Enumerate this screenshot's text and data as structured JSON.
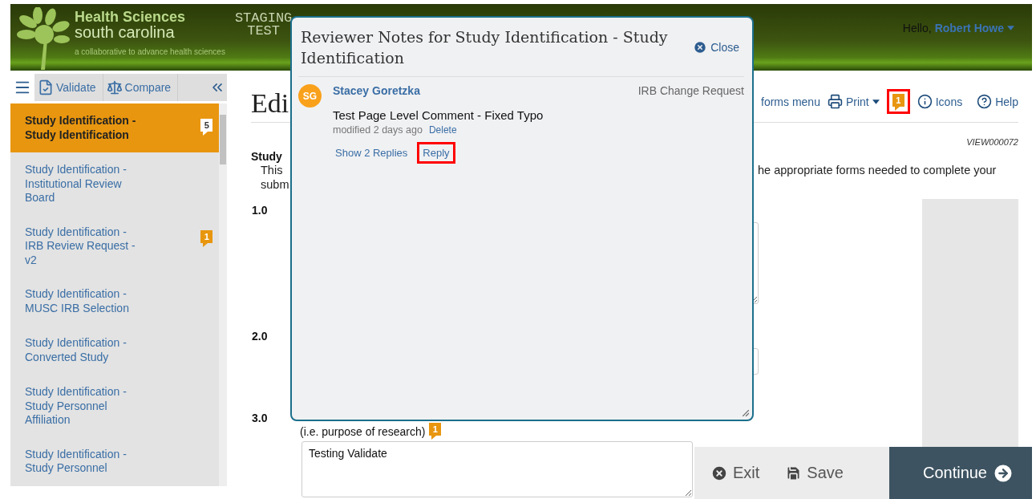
{
  "header": {
    "brand_line1": "Health Sciences",
    "brand_line2": "south carolina",
    "tagline": "a collaborative to advance health sciences",
    "environment": [
      "STAGING",
      "TEST"
    ],
    "greeting": "Hello,",
    "user": "Robert Howe"
  },
  "sidebar": {
    "tools": [
      {
        "kind": "validate",
        "label": "Validate"
      },
      {
        "kind": "compare",
        "label": "Compare"
      }
    ],
    "items": [
      {
        "label": "Study Identification - Study Identification",
        "selected": true,
        "notes": "5"
      },
      {
        "label": "Study Identification - Institutional Review Board",
        "selected": false
      },
      {
        "label": "Study Identification - IRB Review Request - v2",
        "selected": false,
        "notes": "1"
      },
      {
        "label": "Study Identification - MUSC IRB Selection",
        "selected": false
      },
      {
        "label": "Study Identification - Converted Study",
        "selected": false
      },
      {
        "label": "Study Identification - Study Personnel Affiliation",
        "selected": false
      },
      {
        "label": "Study Identification - Study Personnel",
        "selected": false
      }
    ]
  },
  "main": {
    "heading": "Edi",
    "toolbar": [
      {
        "kind": "text",
        "label": "forms menu"
      },
      {
        "kind": "print",
        "label": "Print"
      },
      {
        "kind": "notes",
        "count": "1",
        "highlighted": true
      },
      {
        "kind": "info",
        "label": "Icons"
      },
      {
        "kind": "help",
        "label": "Help"
      }
    ],
    "view_id": "VIEW000072",
    "section_title": "Study",
    "intro_left": [
      "This",
      "subm"
    ],
    "intro_right": "he appropriate forms needed to complete your",
    "questions": [
      {
        "number": "1.0",
        "kind": "textarea"
      },
      {
        "number": "2.0",
        "kind": "input"
      },
      {
        "number": "3.0",
        "kind": "textarea",
        "hint": "(i.e. purpose of research)",
        "notes": "1",
        "value": "Testing Validate"
      }
    ]
  },
  "modal": {
    "title": "Reviewer Notes for Study Identification - Study Identification",
    "close": "Close",
    "notes": [
      {
        "initials": "SG",
        "author": "Stacey Goretzka",
        "type": "IRB Change Request",
        "text": "Test Page Level Comment - Fixed Typo",
        "modified": "modified 2 days ago",
        "delete": "Delete",
        "show_replies": "Show 2 Replies",
        "reply": "Reply",
        "reply_highlighted": true
      }
    ]
  },
  "actions": [
    {
      "kind": "exit",
      "label": "Exit"
    },
    {
      "kind": "save",
      "label": "Save"
    },
    {
      "kind": "continue",
      "label": "Continue"
    }
  ]
}
